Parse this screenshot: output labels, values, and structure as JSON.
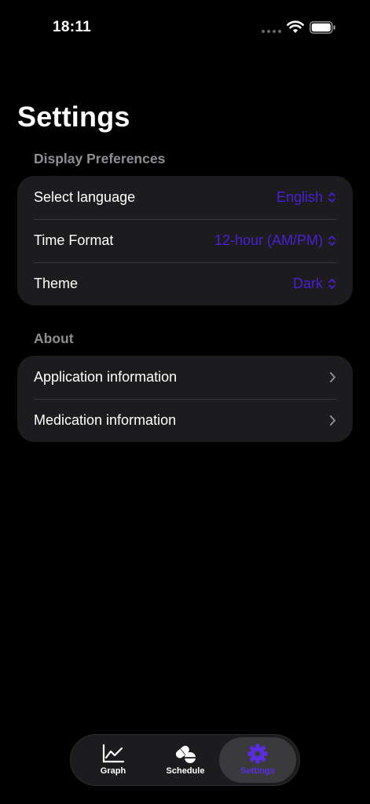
{
  "status_bar": {
    "time": "18:11"
  },
  "page": {
    "title": "Settings"
  },
  "sections": {
    "display": {
      "header": "Display Preferences",
      "rows": [
        {
          "label": "Select language",
          "value": "English"
        },
        {
          "label": "Time Format",
          "value": "12-hour (AM/PM)"
        },
        {
          "label": "Theme",
          "value": "Dark"
        }
      ]
    },
    "about": {
      "header": "About",
      "rows": [
        {
          "label": "Application information"
        },
        {
          "label": "Medication information"
        }
      ]
    }
  },
  "tab_bar": {
    "tabs": [
      {
        "label": "Graph",
        "icon": "chart-line-icon"
      },
      {
        "label": "Schedule",
        "icon": "pills-icon"
      },
      {
        "label": "Settings",
        "icon": "gear-icon",
        "active": true
      }
    ]
  },
  "colors": {
    "accent": "#4a1fd6",
    "background": "#000000",
    "card": "#1c1c1e",
    "secondary_text": "#8e8e93"
  }
}
